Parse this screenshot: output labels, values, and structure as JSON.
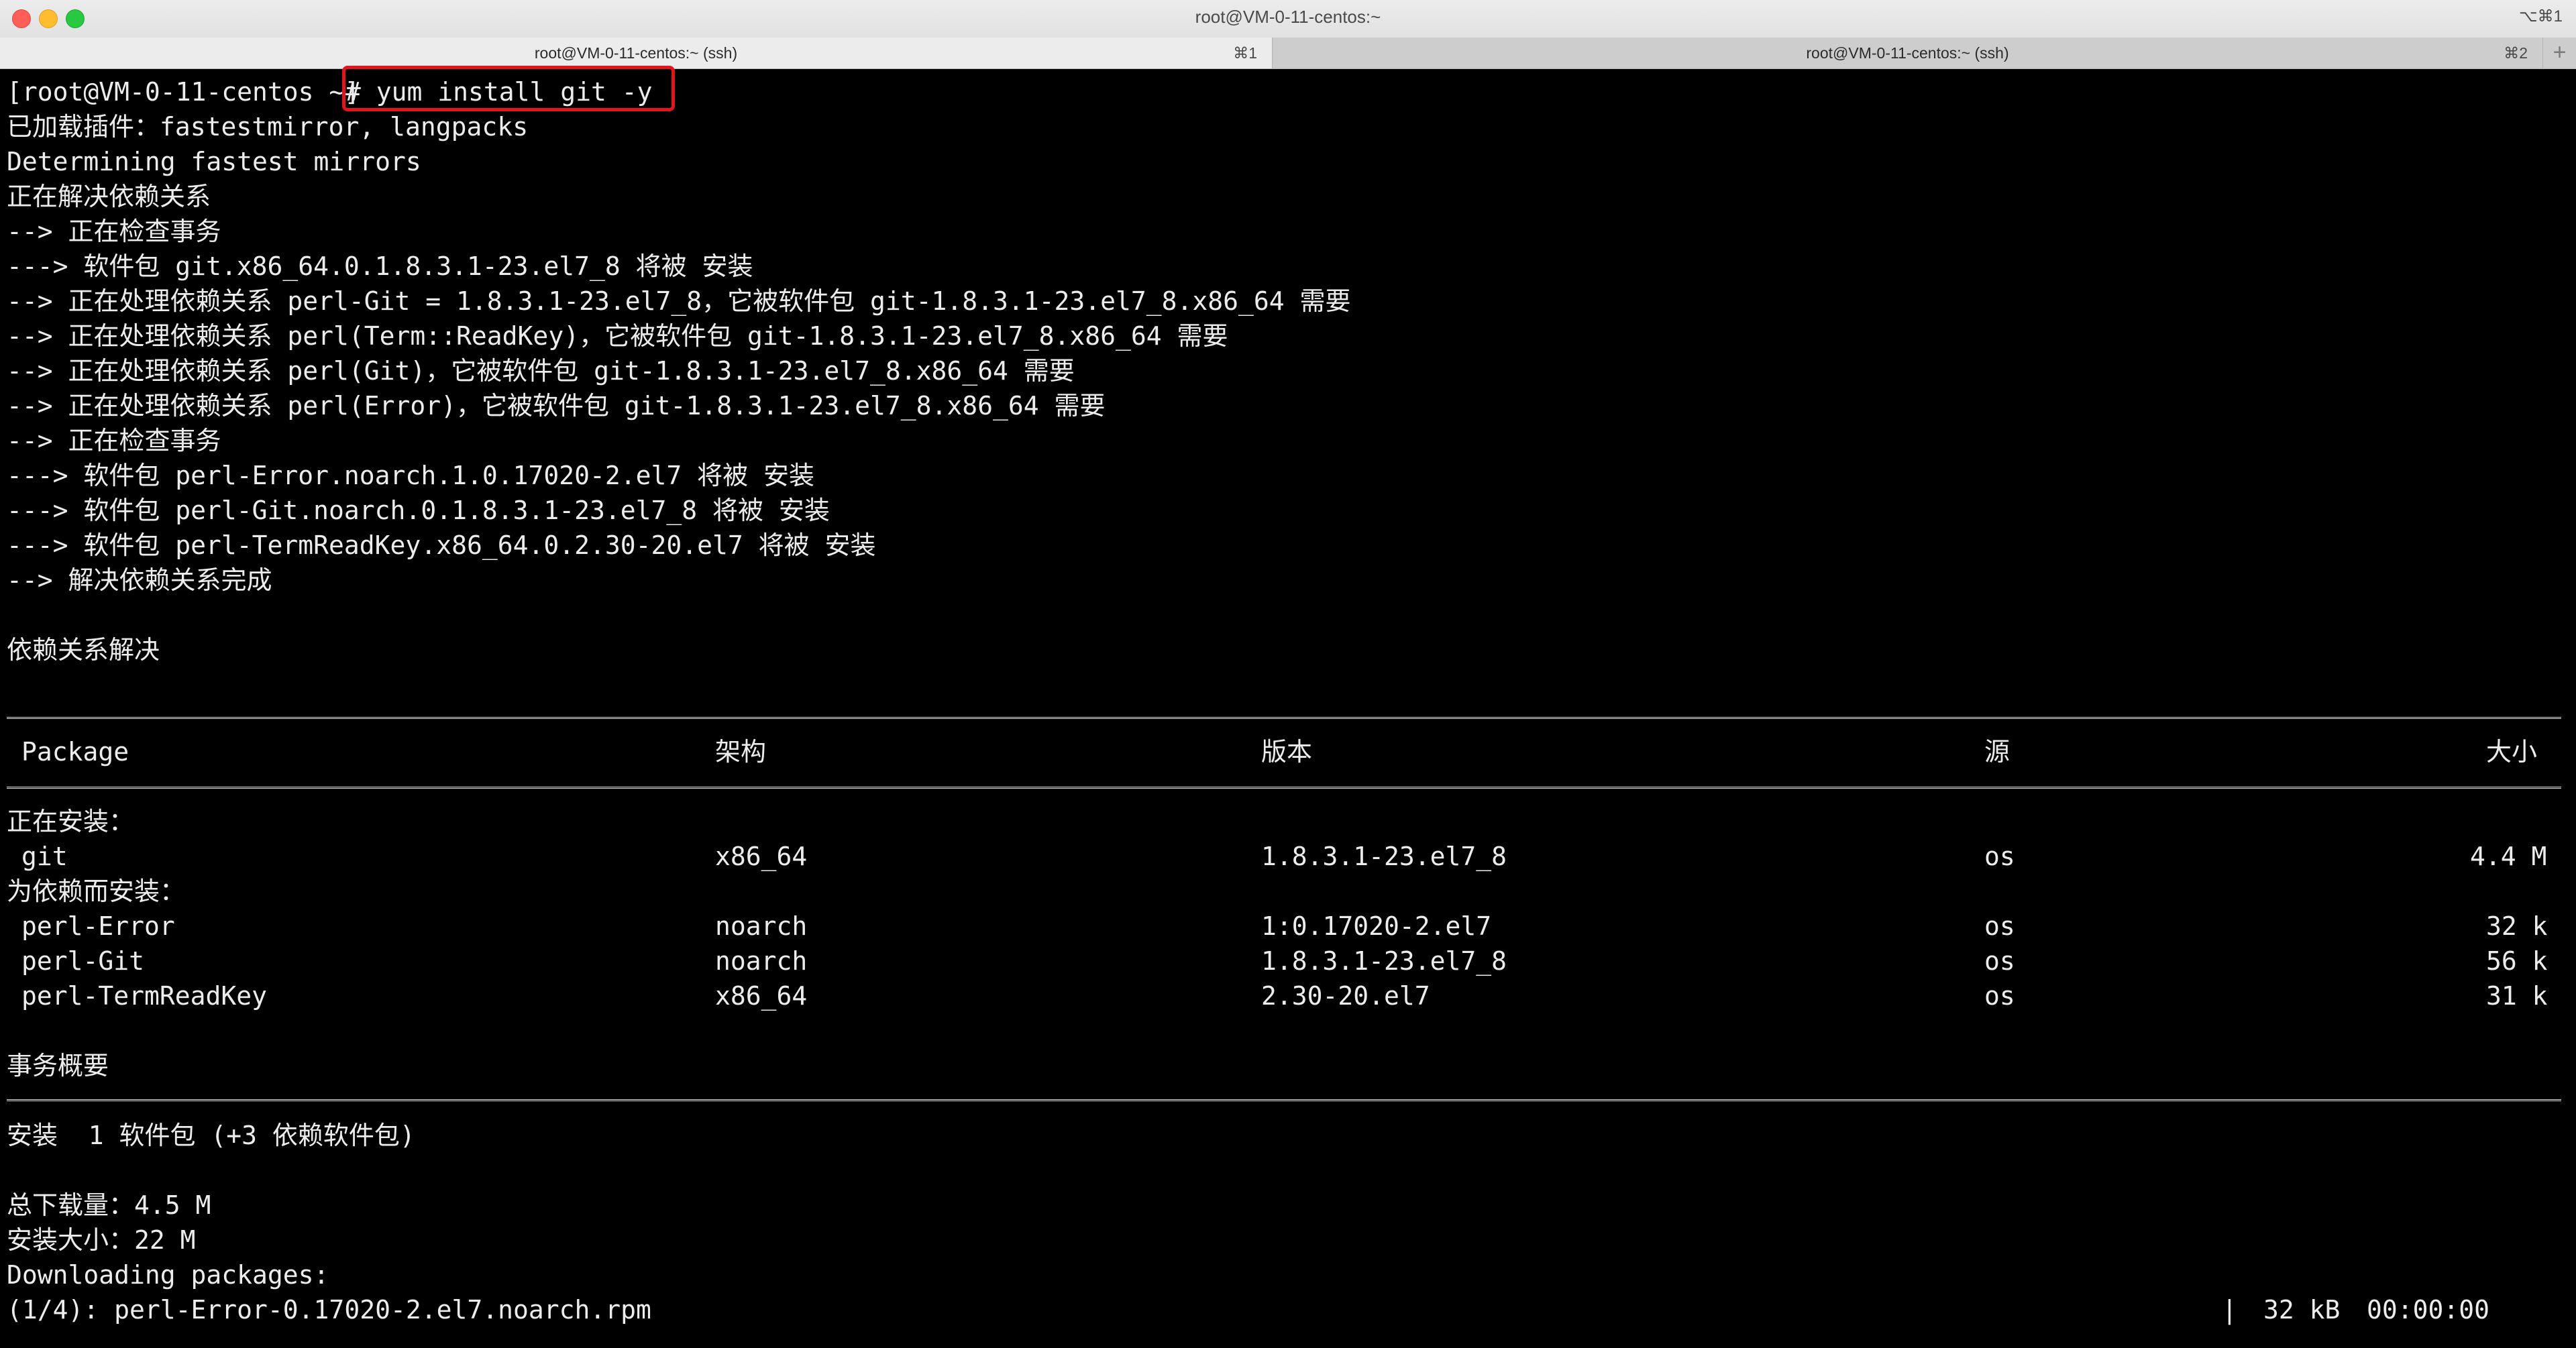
{
  "window": {
    "title": "root@VM-0-11-centos:~",
    "shortcut": "⌥⌘1"
  },
  "tabs": [
    {
      "label": "root@VM-0-11-centos:~ (ssh)",
      "key": "⌘1"
    },
    {
      "label": "root@VM-0-11-centos:~ (ssh)",
      "key": "⌘2"
    }
  ],
  "tab_add": "+",
  "terminal": {
    "prompt": "[root@VM-0-11-centos ~]",
    "command": "# yum install git -y",
    "output": [
      "已加载插件：fastestmirror, langpacks",
      "Determining fastest mirrors",
      "正在解决依赖关系",
      "--> 正在检查事务",
      "---> 软件包 git.x86_64.0.1.8.3.1-23.el7_8 将被 安装",
      "--> 正在处理依赖关系 perl-Git = 1.8.3.1-23.el7_8，它被软件包 git-1.8.3.1-23.el7_8.x86_64 需要",
      "--> 正在处理依赖关系 perl(Term::ReadKey)，它被软件包 git-1.8.3.1-23.el7_8.x86_64 需要",
      "--> 正在处理依赖关系 perl(Git)，它被软件包 git-1.8.3.1-23.el7_8.x86_64 需要",
      "--> 正在处理依赖关系 perl(Error)，它被软件包 git-1.8.3.1-23.el7_8.x86_64 需要",
      "--> 正在检查事务",
      "---> 软件包 perl-Error.noarch.1.0.17020-2.el7 将被 安装",
      "---> 软件包 perl-Git.noarch.0.1.8.3.1-23.el7_8 将被 安装",
      "---> 软件包 perl-TermReadKey.x86_64.0.2.30-20.el7 将被 安装",
      "--> 解决依赖关系完成"
    ],
    "resolved": "依赖关系解决",
    "table": {
      "headers": [
        "Package",
        "架构",
        "版本",
        "源",
        "大小"
      ],
      "installing_label": "正在安装：",
      "installing": [
        [
          "git",
          "x86_64",
          "1.8.3.1-23.el7_8",
          "os",
          "4.4 M"
        ]
      ],
      "deps_label": "为依赖而安装：",
      "deps": [
        [
          "perl-Error",
          "noarch",
          "1:0.17020-2.el7",
          "os",
          "32 k"
        ],
        [
          "perl-Git",
          "noarch",
          "1.8.3.1-23.el7_8",
          "os",
          "56 k"
        ],
        [
          "perl-TermReadKey",
          "x86_64",
          "2.30-20.el7",
          "os",
          "31 k"
        ]
      ]
    },
    "summary_title": "事务概要",
    "summary_line": "安装  1 软件包 (+3 依赖软件包)",
    "total_download": "总下载量：4.5 M",
    "install_size": "安装大小：22 M",
    "downloading": "Downloading packages:",
    "progress": {
      "file": "(1/4): perl-Error-0.17020-2.el7.noarch.rpm",
      "sep": "|",
      "size": "32 kB",
      "time": "00:00:00"
    }
  }
}
